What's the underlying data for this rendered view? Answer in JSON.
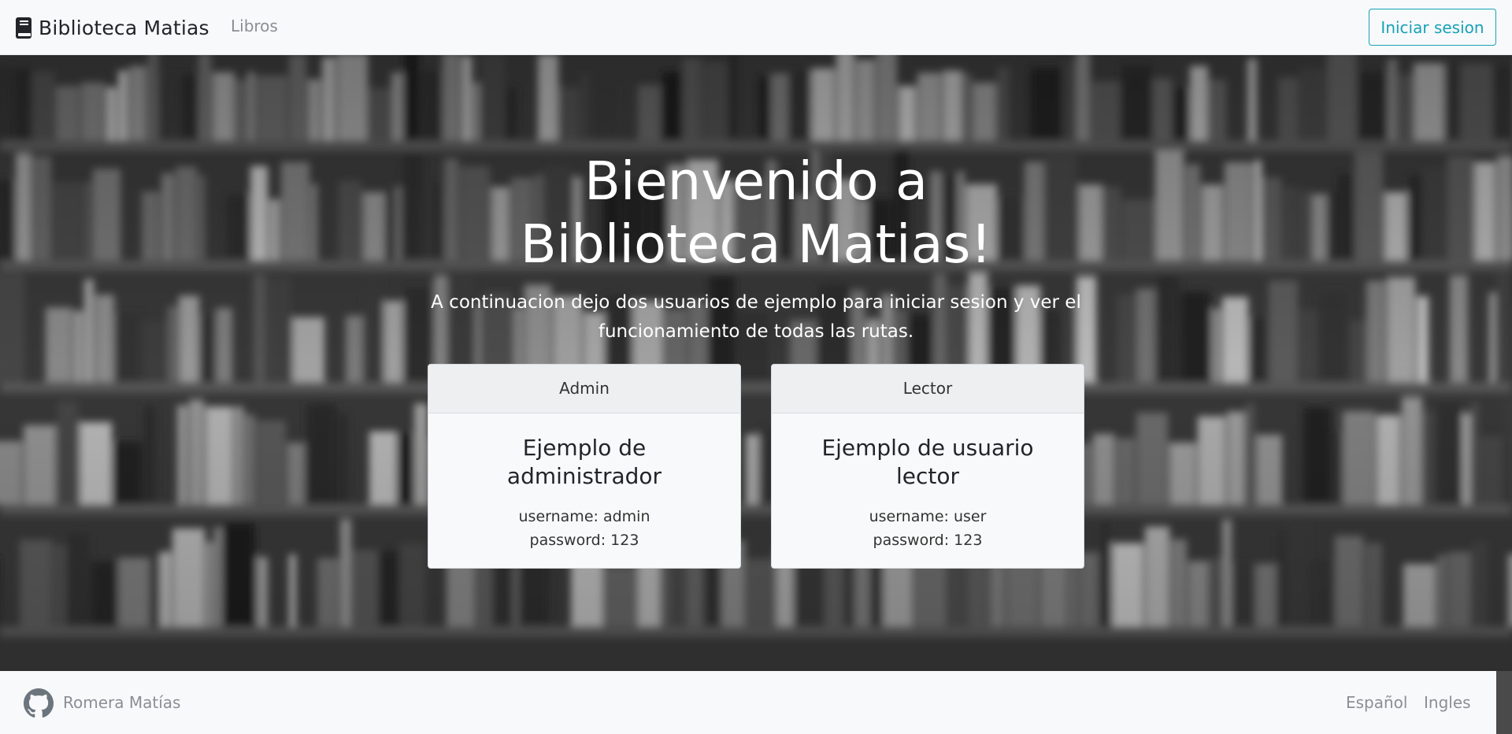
{
  "navbar": {
    "brand_icon": "book-icon",
    "brand": "Biblioteca Matias",
    "link": "Libros",
    "login_label": "Iniciar sesion",
    "accent_color": "#17a2b8"
  },
  "hero": {
    "title_line1": "Bienvenido a",
    "title_line2": "Biblioteca Matias!",
    "subtitle": "A continuacion dejo dos usuarios de ejemplo para iniciar sesion y ver el funcionamiento de todas las rutas.",
    "background": "blurred-bookshelves-grayscale"
  },
  "cards": [
    {
      "header": "Admin",
      "title": "Ejemplo de administrador",
      "username": "username: admin",
      "password": "password: 123"
    },
    {
      "header": "Lector",
      "title": "Ejemplo de usuario lector",
      "username": "username: user",
      "password": "password: 123"
    }
  ],
  "footer": {
    "icon": "github-icon",
    "author": "Romera Matías",
    "languages": [
      "Español",
      "Ingles"
    ]
  }
}
